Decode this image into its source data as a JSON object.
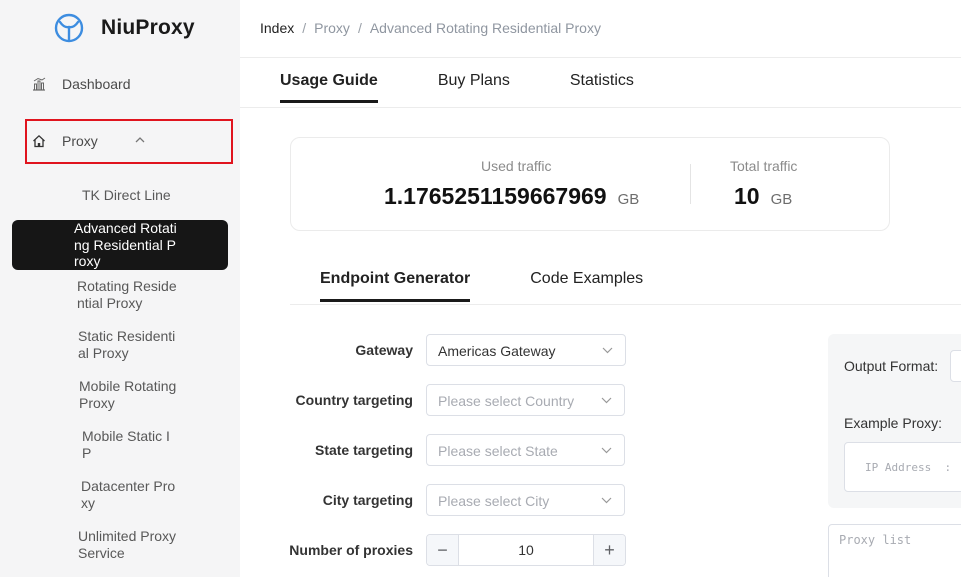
{
  "brand": {
    "name": "NiuProxy",
    "color": "#3d8de0"
  },
  "sidebar": {
    "dashboard_label": "Dashboard",
    "proxy_label": "Proxy",
    "items": [
      "TK Direct Line",
      "Advanced Rotating Residential Proxy",
      "Rotating Residential Proxy",
      "Static Residential Proxy",
      "Mobile Rotating Proxy",
      "Mobile Static IP",
      "Datacenter Proxy",
      "Unlimited Proxy Service"
    ],
    "active_index": 1
  },
  "breadcrumb": [
    "Index",
    "Proxy",
    "Advanced Rotating Residential Proxy"
  ],
  "breadcrumb_separator": "/",
  "tabs": [
    "Usage Guide",
    "Buy Plans",
    "Statistics"
  ],
  "traffic": {
    "used_label": "Used traffic",
    "used_value": "1.1765251159667969",
    "used_unit": "GB",
    "total_label": "Total traffic",
    "total_value": "10",
    "total_unit": "GB"
  },
  "subtabs": [
    "Endpoint Generator",
    "Code Examples"
  ],
  "form": {
    "gateway_label": "Gateway",
    "gateway_value": "Americas Gateway",
    "country_label": "Country targeting",
    "country_placeholder": "Please select Country",
    "state_label": "State targeting",
    "state_placeholder": "Please select State",
    "city_label": "City targeting",
    "city_placeholder": "Please select City",
    "count_label": "Number of proxies",
    "count_value": "10",
    "minus": "−",
    "plus": "+"
  },
  "output": {
    "format_label": "Output Format:",
    "example_label": "Example Proxy:",
    "example_text": "IP Address  :",
    "proxy_list_placeholder": "Proxy list"
  }
}
